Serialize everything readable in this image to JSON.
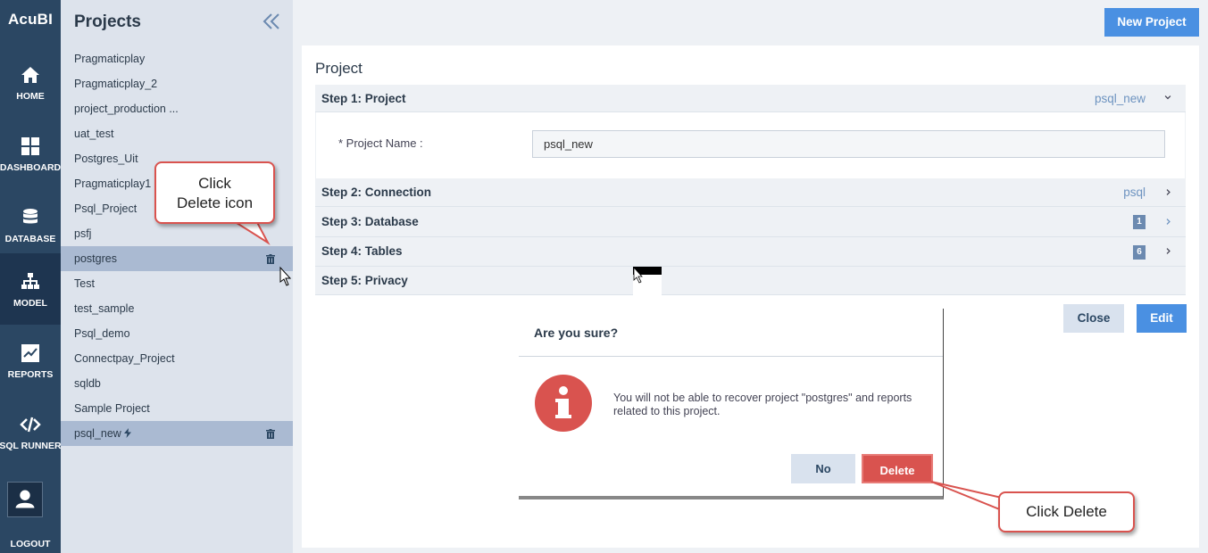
{
  "app": {
    "name": "AcuBI"
  },
  "nav": {
    "items": [
      {
        "label": "HOME",
        "icon": "home-icon"
      },
      {
        "label": "DASHBOARD",
        "icon": "dashboard-icon"
      },
      {
        "label": "DATABASE",
        "icon": "database-icon"
      },
      {
        "label": "MODEL",
        "icon": "model-icon",
        "active": true
      },
      {
        "label": "REPORTS",
        "icon": "reports-icon"
      },
      {
        "label": "SQL RUNNER",
        "icon": "code-icon"
      }
    ],
    "logout_label": "LOGOUT"
  },
  "projects": {
    "title": "Projects",
    "items": [
      {
        "label": "Pragmaticplay"
      },
      {
        "label": "Pragmaticplay_2"
      },
      {
        "label": "project_production ..."
      },
      {
        "label": "uat_test"
      },
      {
        "label": "Postgres_Uit"
      },
      {
        "label": "Pragmaticplay1"
      },
      {
        "label": "Psql_Project"
      },
      {
        "label": "psfj"
      },
      {
        "label": "postgres",
        "selected": true,
        "trash": true
      },
      {
        "label": "Test"
      },
      {
        "label": "test_sample"
      },
      {
        "label": "Psql_demo"
      },
      {
        "label": "Connectpay_Project"
      },
      {
        "label": "sqldb"
      },
      {
        "label": "Sample Project"
      },
      {
        "label": "psql_new",
        "selected": true,
        "trash": true,
        "bolt": true
      }
    ]
  },
  "header": {
    "new_project_label": "New Project"
  },
  "project_card": {
    "title": "Project",
    "steps": [
      {
        "label": "Step 1: Project",
        "value": "psql_new",
        "expanded": true
      },
      {
        "label": "Step 2: Connection",
        "value": "psql"
      },
      {
        "label": "Step 3: Database",
        "badge": "1"
      },
      {
        "label": "Step 4: Tables",
        "badge": "6"
      },
      {
        "label": "Step 5: Privacy"
      }
    ],
    "field_label": "* Project Name :",
    "field_value": "psql_new",
    "close_label": "Close",
    "edit_label": "Edit"
  },
  "dialog": {
    "title": "Are you sure?",
    "message": "You will not be able to recover project \"postgres\" and reports related to this project.",
    "no_label": "No",
    "delete_label": "Delete"
  },
  "callouts": {
    "delete_icon": "Click\nDelete icon",
    "delete_button": "Click Delete"
  },
  "colors": {
    "nav_bg": "#2b4763",
    "accent": "#4a90e2",
    "danger": "#d9534f",
    "selected_row": "#aabad2"
  }
}
